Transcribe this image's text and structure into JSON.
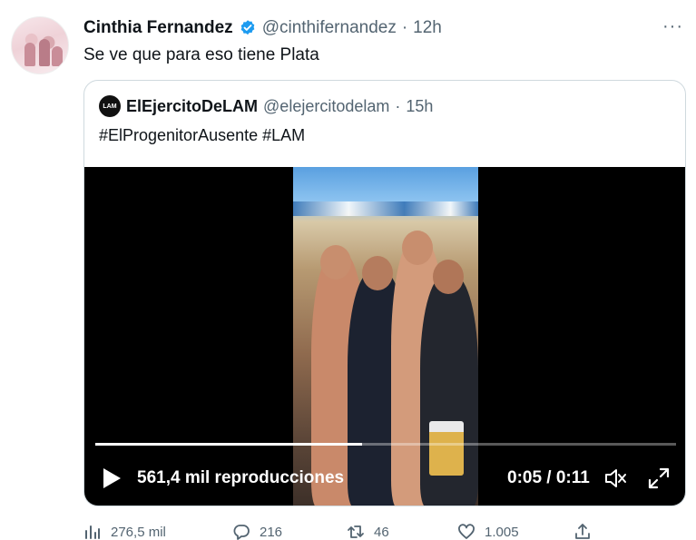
{
  "tweet": {
    "author_name": "Cinthia Fernandez",
    "handle": "@cinthifernandez",
    "separator": "·",
    "time": "12h",
    "more": "···",
    "text": "Se ve que para eso tiene Plata"
  },
  "quote": {
    "avatar_text": "LAM",
    "author_name": "ElEjercitoDeLAM",
    "handle": "@elejercitodelam",
    "separator": "·",
    "time": "15h",
    "text": "#ElProgenitorAusente #LAM"
  },
  "video": {
    "views": "561,4 mil reproducciones",
    "timecode": "0:05 / 0:11",
    "progress": 0.46
  },
  "actions": {
    "views": "276,5 mil",
    "replies": "216",
    "retweets": "46",
    "likes": "1.005"
  },
  "colors": {
    "verified": "#1d9bf0",
    "secondary_text": "#536471",
    "border": "#cfd9de"
  }
}
